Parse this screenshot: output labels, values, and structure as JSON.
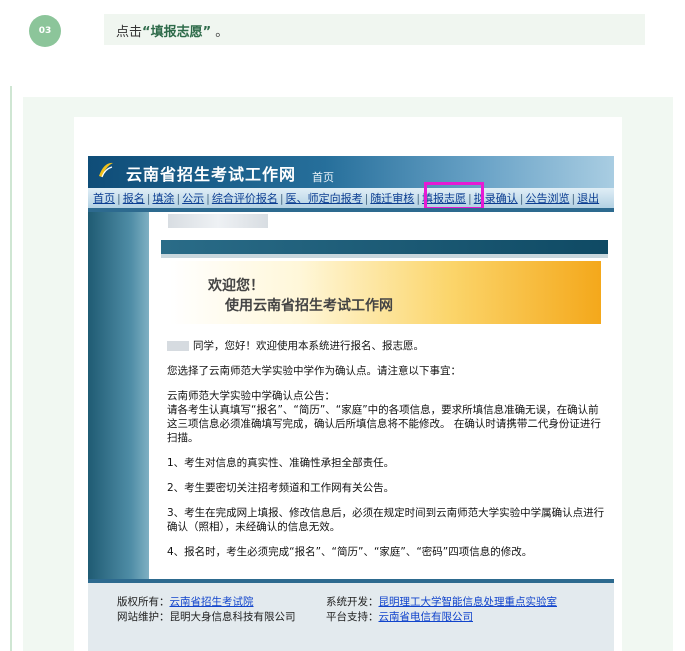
{
  "step": {
    "number": "03",
    "prefix": "点击",
    "quote_open": "“",
    "target": "填报志愿",
    "quote_close": "”",
    "suffix": " 。"
  },
  "site": {
    "title": "云南省招生考试工作网",
    "subtitle": "首页",
    "nav": [
      "首页",
      "报名",
      "填涂",
      "公示",
      "综合评价报名",
      "医、师定向报考",
      "随迁审核",
      "填报志愿",
      "拟录确认",
      "公告浏览",
      "退出"
    ],
    "welcome_line1": "欢迎您！",
    "welcome_line2": "使用云南省招生考试工作网",
    "greeting": "同学，您好！欢迎使用本系统进行报名、报志愿。",
    "chosen": "您选择了云南师范大学实验中学作为确认点。请注意以下事宜：",
    "notice_title": "云南师范大学实验中学确认点公告：",
    "notice_body": "请各考生认真填写“报名”、“简历”、“家庭”中的各项信息，要求所填信息准确无误，在确认前这三项信息必须准确填写完成，确认后所填信息将不能修改。 在确认时请携带二代身份证进行扫描。",
    "item1": "1、考生对信息的真实性、准确性承担全部责任。",
    "item2": "2、考生要密切关注招考频道和工作网有关公告。",
    "item3": "3、考生在完成网上填报、修改信息后，必须在规定时间到云南师范大学实验中学属确认点进行确认（照相），未经确认的信息无效。",
    "item4": "4、报名时，考生必须完成“报名”、“简历”、“家庭”、“密码”四项信息的修改。",
    "footer": {
      "copyright_label": "版权所有：",
      "copyright_link": "云南省招生考试院",
      "dev_label": "系统开发：",
      "dev_link": "昆明理工大学智能信息处理重点实验室",
      "maint_label": "网站维护：",
      "maint_value": "昆明大身信息科技有限公司",
      "support_label": "平台支持：",
      "support_link": "云南省电信有限公司"
    }
  }
}
